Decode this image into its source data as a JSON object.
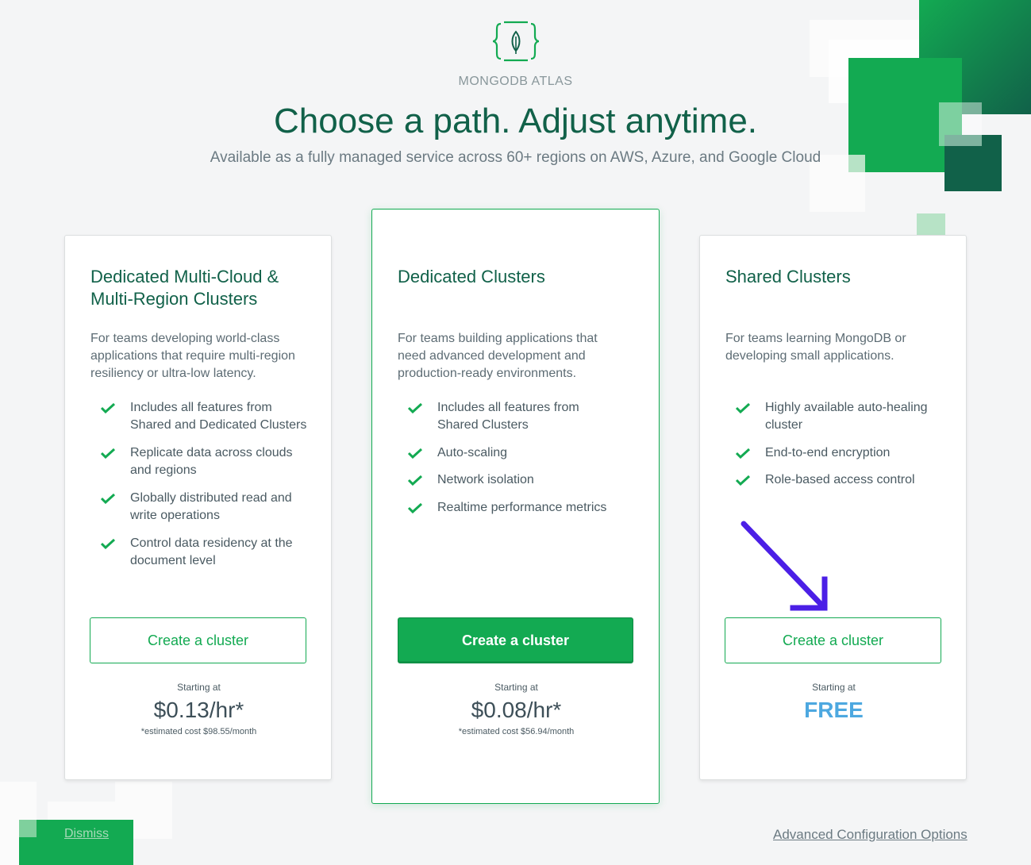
{
  "header": {
    "brand": "MONGODB ATLAS",
    "headline": "Choose a path. Adjust anytime.",
    "subheadline": "Available as a fully managed service across 60+ regions on AWS, Azure, and Google Cloud"
  },
  "cards": [
    {
      "title": "Dedicated Multi-Cloud & Multi-Region Clusters",
      "description": "For teams developing world-class applications that require multi-region resiliency or ultra-low latency.",
      "features": [
        "Includes all features from Shared and Dedicated Clusters",
        "Replicate data across clouds and regions",
        "Globally distributed read and write operations",
        "Control data residency at the document level"
      ],
      "button": "Create a cluster",
      "starting_label": "Starting at",
      "price": "$0.13/hr*",
      "estimate": "*estimated cost $98.55/month"
    },
    {
      "title": "Dedicated Clusters",
      "description": "For teams building applications that need advanced development and production-ready environments.",
      "features": [
        "Includes all features from Shared Clusters",
        "Auto-scaling",
        "Network isolation",
        "Realtime performance metrics"
      ],
      "button": "Create a cluster",
      "starting_label": "Starting at",
      "price": "$0.08/hr*",
      "estimate": "*estimated cost $56.94/month"
    },
    {
      "title": "Shared Clusters",
      "description": "For teams learning MongoDB or developing small applications.",
      "features": [
        "Highly available auto-healing cluster",
        "End-to-end encryption",
        "Role-based access control"
      ],
      "button": "Create a cluster",
      "starting_label": "Starting at",
      "price": "FREE"
    }
  ],
  "footer": {
    "dismiss": "Dismiss",
    "advanced": "Advanced Configuration Options"
  },
  "colors": {
    "brand_green": "#13aa52",
    "dark_green": "#116149",
    "free_blue": "#4da8e0",
    "arrow": "#4b1fe6"
  },
  "icons": [
    "mongodb-leaf-icon",
    "check-icon",
    "arrow-annotation"
  ]
}
